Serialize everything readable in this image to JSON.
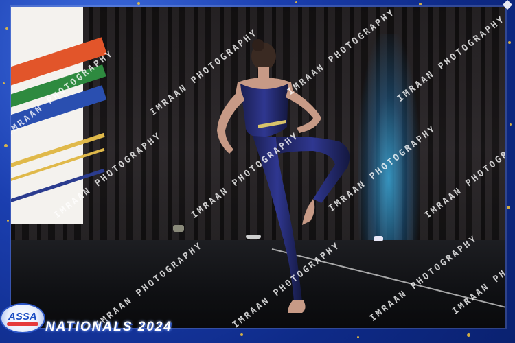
{
  "watermark": {
    "text": "IMRAAN PHOTOGRAPHY"
  },
  "logo": {
    "text": "ASSA"
  },
  "footer": {
    "title": "NATIONALS 2024"
  }
}
